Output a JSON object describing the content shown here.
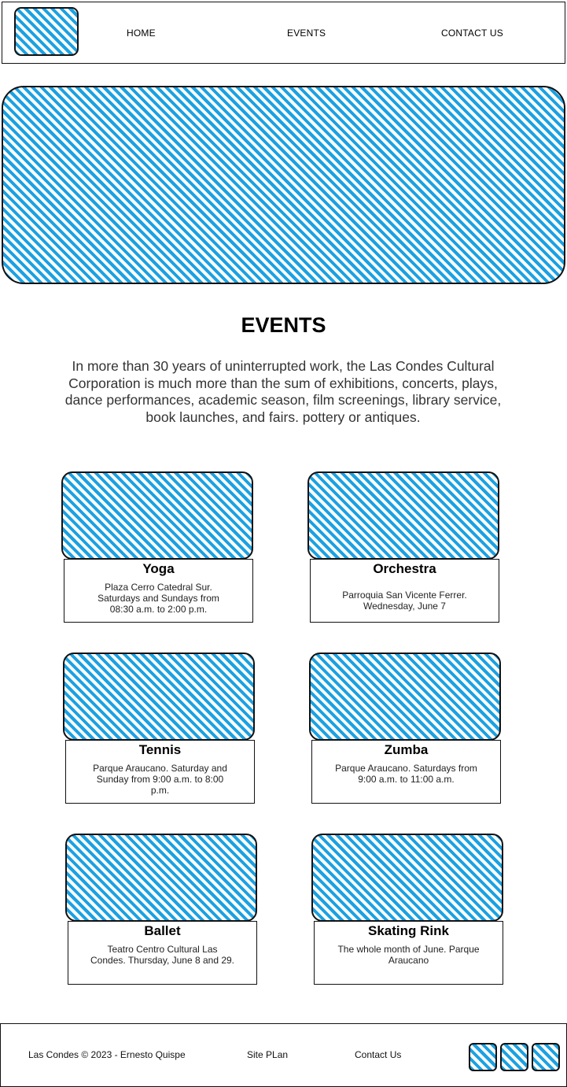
{
  "nav": {
    "home": "HOME",
    "events": "EVENTS",
    "contact": "CONTACT US"
  },
  "section": {
    "title": "EVENTS",
    "intro": "In more than 30 years of uninterrupted work, the Las Condes Cultural Corporation is much more than the sum of exhibitions, concerts, plays, dance performances, academic season, film screenings, library service, book launches, and fairs. pottery or antiques."
  },
  "events": [
    {
      "title": "Yoga",
      "text": "Plaza Cerro Catedral Sur. Saturdays and Sundays from 08:30 a.m. to 2:00 p.m."
    },
    {
      "title": "Orchestra",
      "text": "Parroquia San Vicente Ferrer. Wednesday, June 7"
    },
    {
      "title": "Tennis",
      "text": "Parque Araucano. Saturday and Sunday from 9:00 a.m. to 8:00 p.m."
    },
    {
      "title": "Zumba",
      "text": "Parque Araucano. Saturdays from 9:00 a.m. to 11:00 a.m."
    },
    {
      "title": "Ballet",
      "text": "Teatro Centro Cultural Las Condes. Thursday, June 8 and 29."
    },
    {
      "title": "Skating Rink",
      "text": "The whole month of June. Parque Araucano"
    }
  ],
  "footer": {
    "copyright": "Las Condes © 2023 - Ernesto Quispe",
    "site_plan": "Site PLan",
    "contact": "Contact Us"
  },
  "colors": {
    "hatch": "#1ba1e2",
    "border": "#111111"
  }
}
